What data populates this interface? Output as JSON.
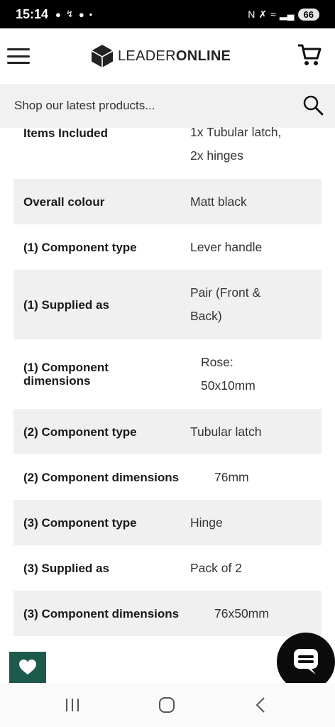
{
  "status_bar": {
    "time": "15:14",
    "battery": "66"
  },
  "header": {
    "logo_text_light": "LEADER",
    "logo_text_bold": "ONLINE"
  },
  "search": {
    "placeholder": "Shop our latest products..."
  },
  "specs": [
    {
      "label": "Items Included",
      "value_lines": [
        "1x Tubular latch,",
        "2x hinges"
      ]
    },
    {
      "label": "Overall colour",
      "value_lines": [
        "Matt black"
      ]
    },
    {
      "label": "(1) Component type",
      "value_lines": [
        "Lever handle"
      ]
    },
    {
      "label": "(1) Supplied as",
      "value_lines": [
        "Pair (Front &",
        "Back)"
      ]
    },
    {
      "label_lines": [
        "(1) Component",
        "dimensions"
      ],
      "value_lines": [
        "Rose:",
        "50x10mm"
      ]
    },
    {
      "label": "(2) Component type",
      "value_lines": [
        "Tubular latch"
      ]
    },
    {
      "label": "(2) Component dimensions",
      "value_lines": [
        "76mm"
      ]
    },
    {
      "label": "(3) Component type",
      "value_lines": [
        "Hinge"
      ]
    },
    {
      "label": "(3) Supplied as",
      "value_lines": [
        "Pack of 2"
      ]
    },
    {
      "label": "(3) Component dimensions",
      "value_lines": [
        "76x50mm"
      ]
    }
  ],
  "icons": {
    "menu": "hamburger-menu-icon",
    "cart": "shopping-cart-icon",
    "search": "search-icon",
    "wishlist": "heart-icon",
    "chat": "chat-icon"
  },
  "colors": {
    "status_bar": "#000000",
    "row_shade": "#f0f0f0",
    "wishlist_bg": "#1e5a4c",
    "chat_bg": "#0b0b0b"
  }
}
